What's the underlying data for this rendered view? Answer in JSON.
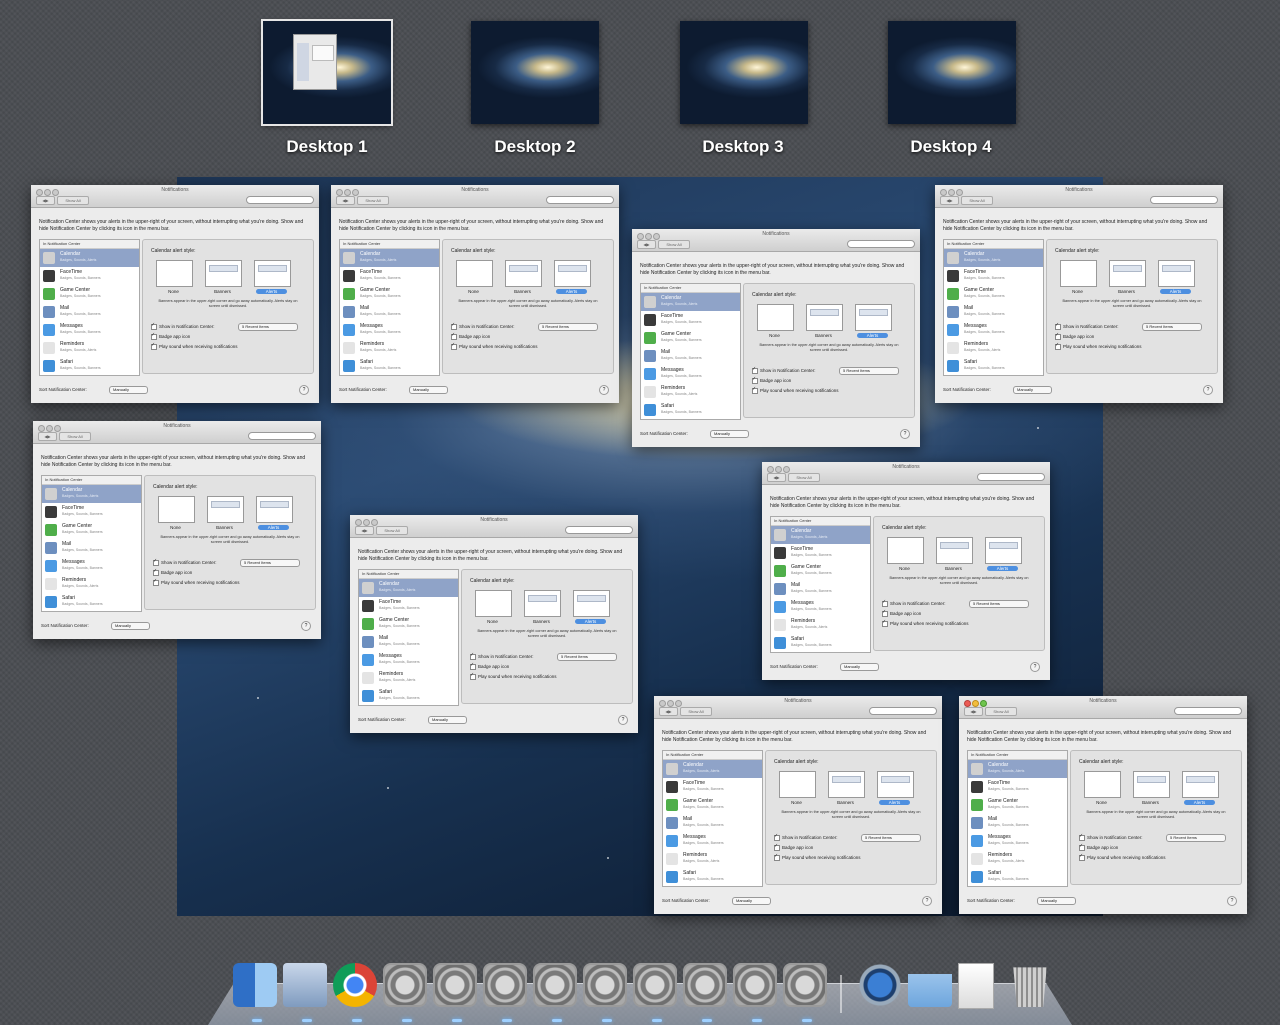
{
  "spaces": [
    {
      "label": "Desktop 1",
      "active": true
    },
    {
      "label": "Desktop 2",
      "active": false
    },
    {
      "label": "Desktop 3",
      "active": false
    },
    {
      "label": "Desktop 4",
      "active": false
    }
  ],
  "prefs": {
    "window_title": "Notifications",
    "nav_back": "◀",
    "nav_fwd": "▶",
    "show_all": "Show All",
    "description": "Notification Center shows your alerts in the upper-right of your screen, without interrupting what you're doing. Show and hide Notification Center by clicking its icon in the menu bar.",
    "list_header": "In Notification Center",
    "apps": [
      {
        "name": "Calendar",
        "sub": "Badges, Sounds, Alerts",
        "icon": "calendar-icon",
        "color": "#d0d0d0",
        "selected": true
      },
      {
        "name": "FaceTime",
        "sub": "Badges, Sounds, Banners",
        "icon": "facetime-icon",
        "color": "#3a3a3a"
      },
      {
        "name": "Game Center",
        "sub": "Badges, Sounds, Banners",
        "icon": "game-center-icon",
        "color": "#4fae4a"
      },
      {
        "name": "Mail",
        "sub": "Badges, Sounds, Banners",
        "icon": "mail-icon",
        "color": "#6d8fbf"
      },
      {
        "name": "Messages",
        "sub": "Badges, Sounds, Banners",
        "icon": "messages-icon",
        "color": "#4b9ae3"
      },
      {
        "name": "Reminders",
        "sub": "Badges, Sounds, Alerts",
        "icon": "reminders-icon",
        "color": "#e4e4e4"
      },
      {
        "name": "Safari",
        "sub": "Badges, Sounds, Banners",
        "icon": "safari-icon",
        "color": "#3f8fd8"
      }
    ],
    "alert_style_label": "Calendar alert style:",
    "style_none": "None",
    "style_banners": "Banners",
    "style_alerts": "Alerts",
    "style_hint": "Banners appear in the upper-right corner and go away automatically. Alerts stay on screen until dismissed.",
    "show_in_nc": "Show in Notification Center:",
    "recent_items": "5 Recent Items",
    "badge_app_icon": "Badge app icon",
    "play_sound": "Play sound when receiving notifications",
    "sort_label": "Sort Notification Center:",
    "sort_value": "Manually",
    "help": "?"
  },
  "dock": {
    "items": [
      {
        "name": "finder-icon",
        "color": "#4f8fdc"
      },
      {
        "name": "mail-stamp-icon",
        "color": "#9fb7d6"
      },
      {
        "name": "chrome-icon",
        "color": "#dd4b39"
      },
      {
        "name": "system-preferences-icon",
        "color": "#8a8a8a"
      },
      {
        "name": "system-preferences-icon",
        "color": "#8a8a8a"
      },
      {
        "name": "system-preferences-icon",
        "color": "#8a8a8a"
      },
      {
        "name": "system-preferences-icon",
        "color": "#8a8a8a"
      },
      {
        "name": "system-preferences-icon",
        "color": "#8a8a8a"
      },
      {
        "name": "system-preferences-icon",
        "color": "#8a8a8a"
      },
      {
        "name": "system-preferences-icon",
        "color": "#8a8a8a"
      },
      {
        "name": "system-preferences-icon",
        "color": "#8a8a8a"
      },
      {
        "name": "system-preferences-icon",
        "color": "#8a8a8a"
      }
    ],
    "stacks": [
      {
        "name": "applications-stack-icon",
        "color": "#6aa6e0"
      },
      {
        "name": "downloads-folder-icon",
        "color": "#8fb9e6"
      },
      {
        "name": "document-stack-icon",
        "color": "#f2f2f2"
      },
      {
        "name": "trash-icon",
        "color": "#b5b5b5"
      }
    ]
  }
}
